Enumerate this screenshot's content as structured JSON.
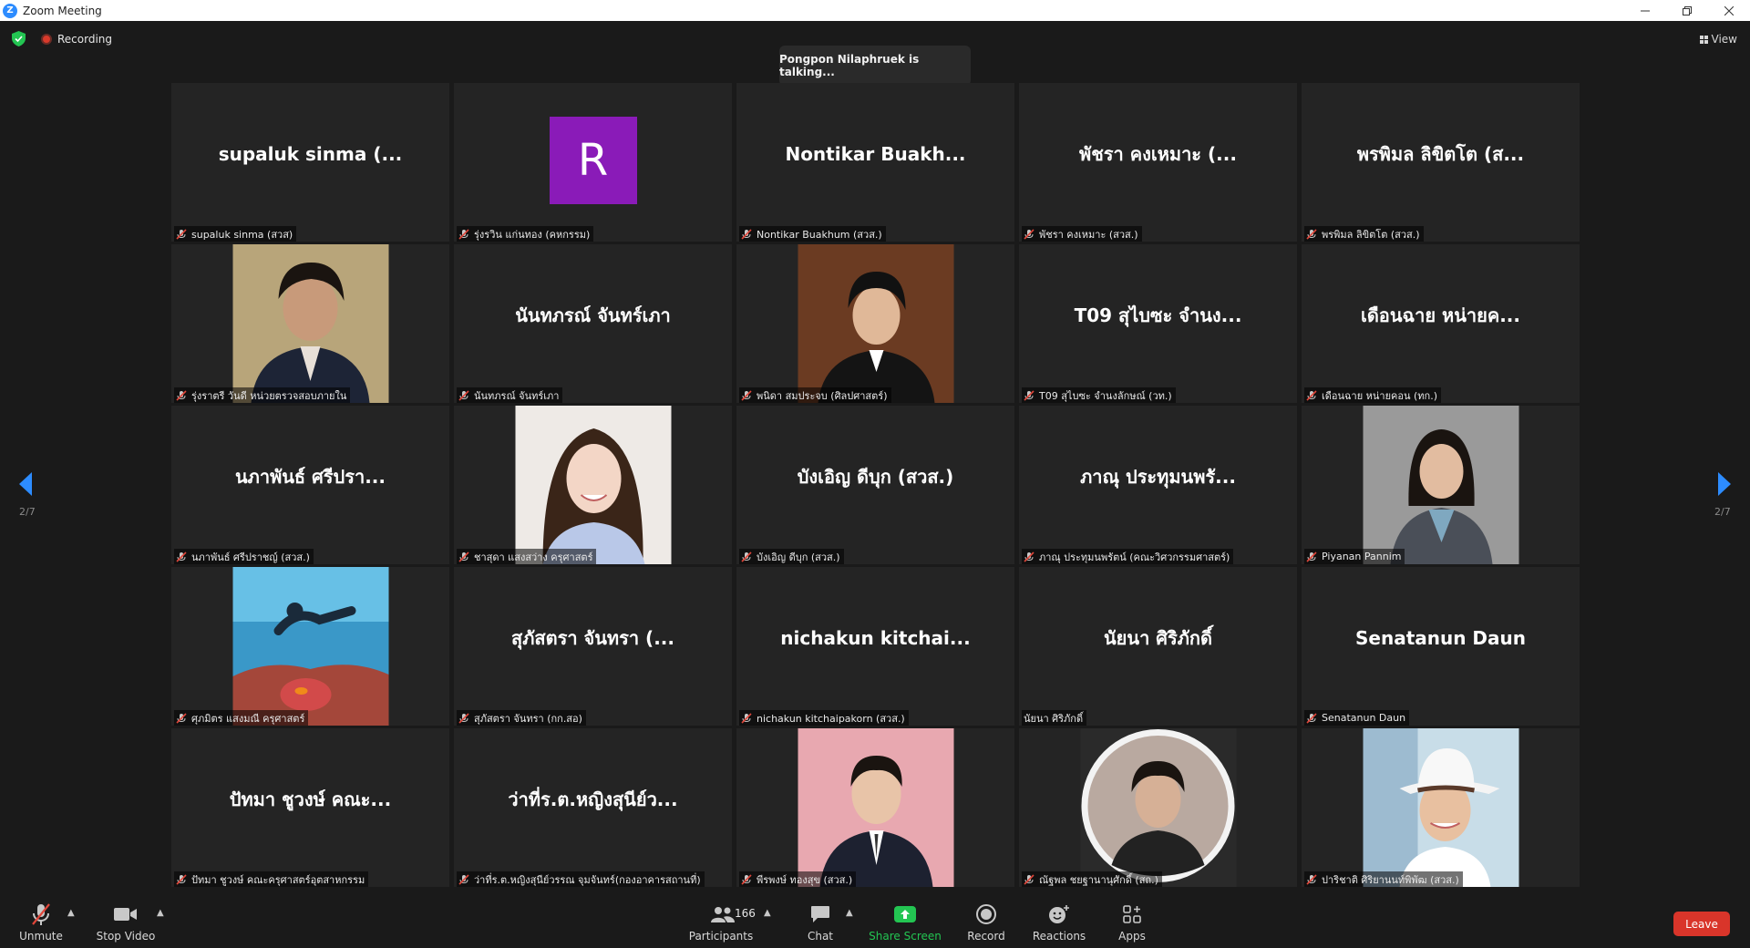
{
  "window": {
    "title": "Zoom Meeting",
    "logo_letter": "Z"
  },
  "topbar": {
    "recording_label": "Recording",
    "talking_banner": "Pongpon Nilaphruek is talking...",
    "view_label": "View"
  },
  "colors": {
    "accent": "#2d8cff",
    "leave": "#d9352a",
    "share_green": "#23c552",
    "avatar_purple": "#8a1bb8"
  },
  "pagination": {
    "left_page": "2/7",
    "right_page": "2/7"
  },
  "tiles": [
    {
      "big_name": "supaluk sinma (...",
      "label": "supaluk sinma (สวส)",
      "kind": "name",
      "muted": true
    },
    {
      "big_name": "",
      "label": "รุ่งรวิน แก่นทอง (คหกรรม)",
      "kind": "avatar",
      "avatar_letter": "R",
      "muted": true
    },
    {
      "big_name": "Nontikar Buakh...",
      "label": "Nontikar Buakhum (สวส.)",
      "kind": "name",
      "muted": true
    },
    {
      "big_name": "พัชรา คงเหมาะ (...",
      "label": "พัชรา คงเหมาะ (สวส.)",
      "kind": "name",
      "muted": true
    },
    {
      "big_name": "พรพิมล ลิขิตโต (ส...",
      "label": "พรพิมล ลิขิตโต (สวส.)",
      "kind": "name",
      "muted": true
    },
    {
      "big_name": "",
      "label": "รุ่งราตรี วันดี หน่วยตรวจสอบภายใน",
      "kind": "photo",
      "photo": "woman-portrait-beige",
      "muted": true
    },
    {
      "big_name": "นันทภรณ์ จันทร์เภา",
      "label": "นันทภรณ์ จันทร์เภา",
      "kind": "name",
      "muted": true
    },
    {
      "big_name": "",
      "label": "พนิดา สมประจบ (ศิลปศาสตร์)",
      "kind": "photo",
      "photo": "woman-portrait-brown",
      "muted": true
    },
    {
      "big_name": "T09 สุไบซะ จำนง...",
      "label": "T09 สุไบซะ จำนงลักษณ์ (วท.)",
      "kind": "name",
      "muted": true
    },
    {
      "big_name": "เดือนฉาย หน่ายค...",
      "label": "เดือนฉาย หน่ายคอน (ทก.)",
      "kind": "name",
      "muted": true
    },
    {
      "big_name": "นภาพันธ์ ศรีปรา...",
      "label": "นภาพันธ์ ศรีปราชญ์ (สวส.)",
      "kind": "name",
      "muted": true
    },
    {
      "big_name": "",
      "label": "ชาสุดา แสงสว่าง ครุศาสตร์",
      "kind": "photo",
      "photo": "woman-smiling-portrait",
      "muted": true
    },
    {
      "big_name": "บังเอิญ ดีบุก (สวส.)",
      "label": "บังเอิญ ดีบุก (สวส.)",
      "kind": "name",
      "muted": true
    },
    {
      "big_name": "ภาณุ ประทุมนพรั...",
      "label": "ภาณุ ประทุมนพรัตน์ (คณะวิศวกรรมศาสตร์)",
      "kind": "name",
      "muted": true
    },
    {
      "big_name": "",
      "label": "Piyanan Pannim",
      "kind": "photo",
      "photo": "woman-grey-background",
      "muted": true
    },
    {
      "big_name": "",
      "label": "ศุภมิตร แสงมณี ครุศาสตร์",
      "kind": "photo",
      "photo": "diver-underwater",
      "muted": true
    },
    {
      "big_name": "สุภัสตรา จันทรา (...",
      "label": "สุภัสตรา จันทรา (กก.สอ)",
      "kind": "name",
      "muted": true
    },
    {
      "big_name": "nichakun kitchai...",
      "label": "nichakun kitchaipakorn (สวส.)",
      "kind": "name",
      "muted": true
    },
    {
      "big_name": "นัยนา ศิริภักดิ์",
      "label": "นัยนา ศิริภักดิ์",
      "kind": "name",
      "muted": false
    },
    {
      "big_name": "Senatanun Daun",
      "label": "Senatanun Daun",
      "kind": "name",
      "muted": true
    },
    {
      "big_name": "ปัทมา ชูวงษ์ คณะ...",
      "label": "ปัทมา ชูวงษ์ คณะครุศาสตร์อุตสาหกรรม",
      "kind": "name",
      "muted": true
    },
    {
      "big_name": "ว่าที่ร.ต.หญิงสุนีย์ว...",
      "label": "ว่าที่ร.ต.หญิงสุนีย์วรรณ จุมจันทร์(กองอาคารสถานที่)",
      "kind": "name",
      "muted": true
    },
    {
      "big_name": "",
      "label": "พีรพงษ์ ทองสุข (สวส.)",
      "kind": "photo",
      "photo": "man-pink-background",
      "muted": true
    },
    {
      "big_name": "",
      "label": "ณัฐพล ชยฐานานุศักดิ์ (สถ.)",
      "kind": "photo",
      "photo": "man-circle-frame",
      "muted": true
    },
    {
      "big_name": "",
      "label": "ปาริชาติ ศิริยานนท์พิพัฒ (สวส.)",
      "kind": "photo",
      "photo": "woman-white-hat",
      "muted": true
    }
  ],
  "toolbar": {
    "unmute": "Unmute",
    "stop_video": "Stop Video",
    "participants": "Participants",
    "participant_count": "166",
    "chat": "Chat",
    "share_screen": "Share Screen",
    "record": "Record",
    "reactions": "Reactions",
    "apps": "Apps",
    "leave": "Leave"
  }
}
